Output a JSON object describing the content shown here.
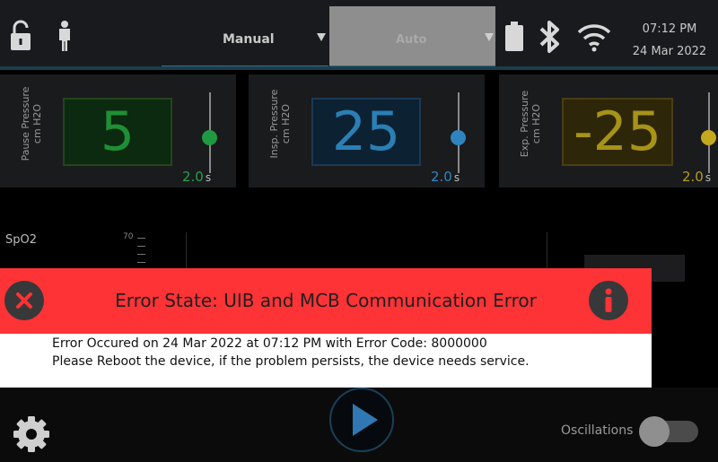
{
  "top_bar": {
    "lock_icon": "lock-open-icon",
    "person_icon": "person-icon",
    "modes": [
      {
        "label": "Manual",
        "selected": true
      },
      {
        "label": "Auto",
        "selected": false
      }
    ],
    "status_icons": [
      "battery-icon",
      "bluetooth-icon",
      "wifi-icon"
    ],
    "time": "07:12 PM",
    "date": "24 Mar 2022"
  },
  "panels": [
    {
      "label": "Pause Pressure",
      "unit": "cm H2O",
      "value": "5",
      "time": "2.0",
      "time_unit": "s",
      "color": "#1f8f35"
    },
    {
      "label": "Insp. Pressure",
      "unit": "cm H2O",
      "value": "25",
      "time": "2.0",
      "time_unit": "s",
      "color": "#2a7fb5"
    },
    {
      "label": "Exp. Pressure",
      "unit": "cm H2O",
      "value": "-25",
      "time": "2.0",
      "time_unit": "s",
      "color": "#a69318"
    }
  ],
  "graph": {
    "spo2_label": "SpO2",
    "scale_top": "70"
  },
  "error": {
    "title": "Error State: UIB and MCB Communication Error",
    "line1": "Error Occured on 24 Mar 2022 at 07:12 PM with Error Code: 8000000",
    "line2": "Please Reboot the device, if the problem persists, the device needs service.",
    "close_icon": "close-icon",
    "info_icon": "info-icon",
    "header_color": "#fd3336"
  },
  "bottom_bar": {
    "settings_icon": "gear-icon",
    "play_icon": "play-icon",
    "oscillations_label": "Oscillations",
    "oscillations_on": false
  }
}
